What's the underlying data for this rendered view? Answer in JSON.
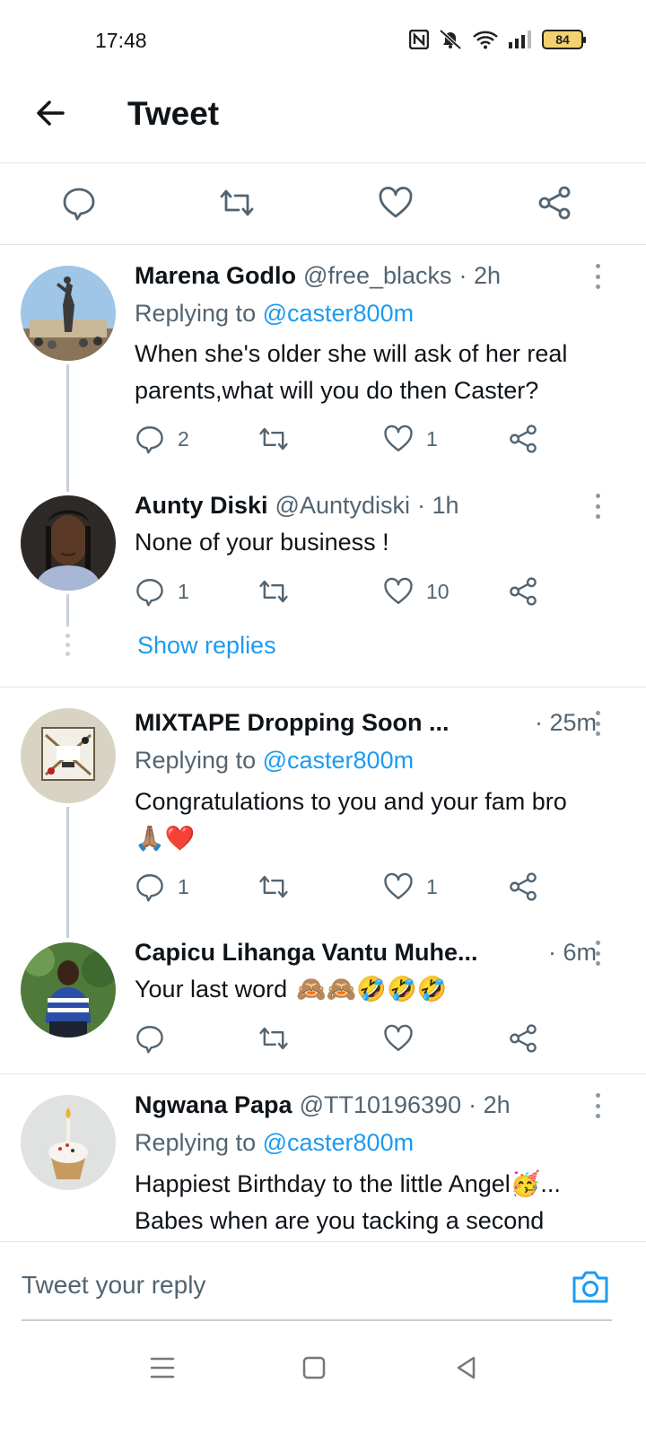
{
  "status": {
    "time": "17:48",
    "battery": "84"
  },
  "header": {
    "title": "Tweet"
  },
  "tweets": [
    {
      "name": "Marena Godlo",
      "handle": "@free_blacks",
      "time": "· 2h",
      "replying_label": "Replying to",
      "replying_to": "@caster800m",
      "text": "When she's older she will ask of her real parents,what will you do then Caster?",
      "replies": "2",
      "likes": "1"
    },
    {
      "name": "Aunty Diski",
      "handle": "@Auntydiski",
      "time": "· 1h",
      "text": "None of your business !",
      "replies": "1",
      "likes": "10"
    },
    {
      "name": "MIXTAPE Dropping Soon ...",
      "time": "· 25m",
      "replying_label": "Replying to",
      "replying_to": "@caster800m",
      "text": "Congratulations to you and your fam bro",
      "emoji": "🙏🏽❤️",
      "replies": "1",
      "likes": "1"
    },
    {
      "name": "Capicu Lihanga Vantu Muhe...",
      "time": "· 6m",
      "text": "Your last word",
      "emoji": "🙈🙈🤣🤣🤣"
    },
    {
      "name": "Ngwana Papa",
      "handle": "@TT10196390",
      "time": "· 2h",
      "replying_label": "Replying to",
      "replying_to": "@caster800m",
      "text_line1": "Happiest Birthday to the little Angel🥳...",
      "text_line2": "Babes when are you tacking a second"
    }
  ],
  "show_replies": "Show replies",
  "reply_bar": {
    "placeholder": "Tweet your reply"
  },
  "colors": {
    "accent": "#1d9bf0",
    "secondary_text": "#536471",
    "thread_line": "#c7d0d8"
  }
}
